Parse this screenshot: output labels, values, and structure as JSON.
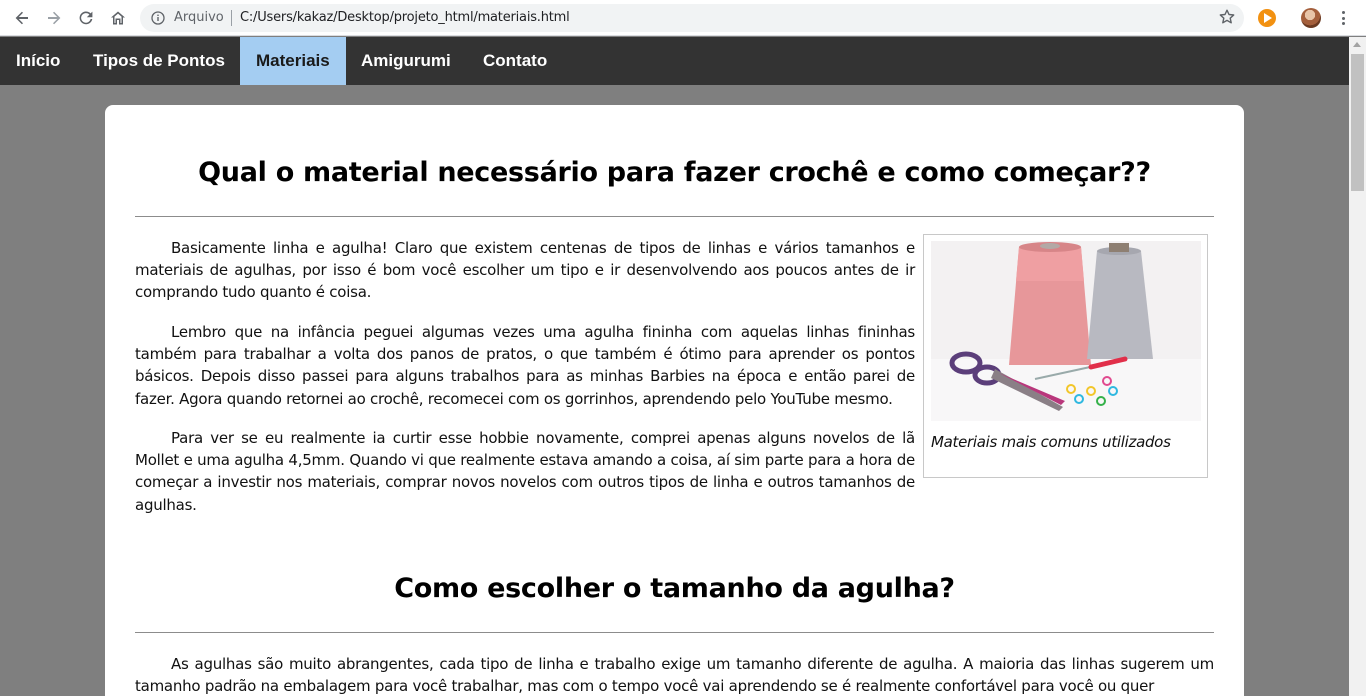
{
  "browser": {
    "security_label": "Arquivo",
    "url": "C:/Users/kakaz/Desktop/projeto_html/materiais.html",
    "icons": [
      "back-icon",
      "forward-icon",
      "reload-icon",
      "home-icon",
      "info-icon",
      "star-icon",
      "extension-icon",
      "profile-avatar",
      "menu-icon"
    ]
  },
  "nav": {
    "items": [
      {
        "label": "Início"
      },
      {
        "label": "Tipos de Pontos"
      },
      {
        "label": "Materiais",
        "active": true
      },
      {
        "label": "Amigurumi"
      },
      {
        "label": "Contato"
      }
    ],
    "bg_color": "#333333",
    "active_color": "#a4cdf2"
  },
  "section1": {
    "title": "Qual o material necessário para fazer crochê e como começar??",
    "paragraphs": [
      "Basicamente linha e agulha! Claro que existem centenas de tipos de linhas e vários tamanhos e materiais de agulhas, por isso é bom você escolher um tipo e ir desenvolvendo aos poucos antes de ir comprando tudo quanto é coisa.",
      "Lembro que na infância peguei algumas vezes uma agulha fininha com aquelas linhas fininhas também para trabalhar a volta dos panos de pratos, o que também é ótimo para aprender os pontos básicos. Depois disso passei para alguns trabalhos para as minhas Barbies na época e então parei de fazer. Agora quando retornei ao crochê, recomecei com os gorrinhos, aprendendo pelo YouTube mesmo.",
      "Para ver se eu realmente ia curtir esse hobbie novamente, comprei apenas alguns novelos de lã Mollet e uma agulha 4,5mm. Quando vi que realmente estava amando a coisa, aí sim parte para a hora de começar a investir nos materiais, comprar novos novelos com outros tipos de linha e outros tamanhos de agulhas."
    ],
    "figure_caption": "Materiais mais comuns utilizados"
  },
  "section2": {
    "title": "Como escolher o tamanho da agulha?",
    "paragraphs": [
      "As agulhas são muito abrangentes, cada tipo de linha e trabalho exige um tamanho diferente de agulha. A maioria das linhas sugerem um tamanho padrão na embalagem para você trabalhar, mas com o tempo você vai aprendendo se é realmente confortável para você ou quer"
    ]
  }
}
